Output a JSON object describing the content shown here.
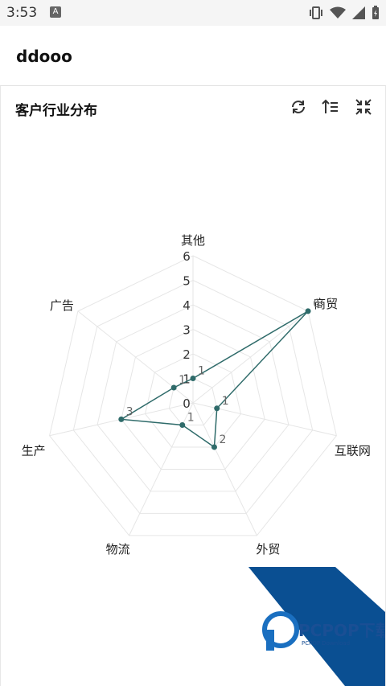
{
  "status_bar": {
    "time": "3:53",
    "indicator": "A"
  },
  "app_bar": {
    "title": "ddooo"
  },
  "chart_card": {
    "title": "客户行业分布",
    "tools": [
      "refresh-icon",
      "sort-icon",
      "collapse-icon"
    ]
  },
  "chart_data": {
    "type": "radar",
    "title": "客户行业分布",
    "indicators": [
      "其他",
      "商贸",
      "互联网",
      "外贸",
      "物流",
      "生产",
      "广告"
    ],
    "values": [
      1,
      6,
      1,
      2,
      1,
      3,
      1
    ],
    "ticks": [
      0,
      1,
      2,
      3,
      4,
      5,
      6
    ],
    "max": 6,
    "series_color": "#2f6b6a",
    "grid_color": "#e6e6e6"
  },
  "watermark": {
    "brand": "PCPOP下载",
    "sub": "PCPOP Download",
    "colors": {
      "stripe": "#0a4f92",
      "text": "#1a4f94"
    }
  }
}
